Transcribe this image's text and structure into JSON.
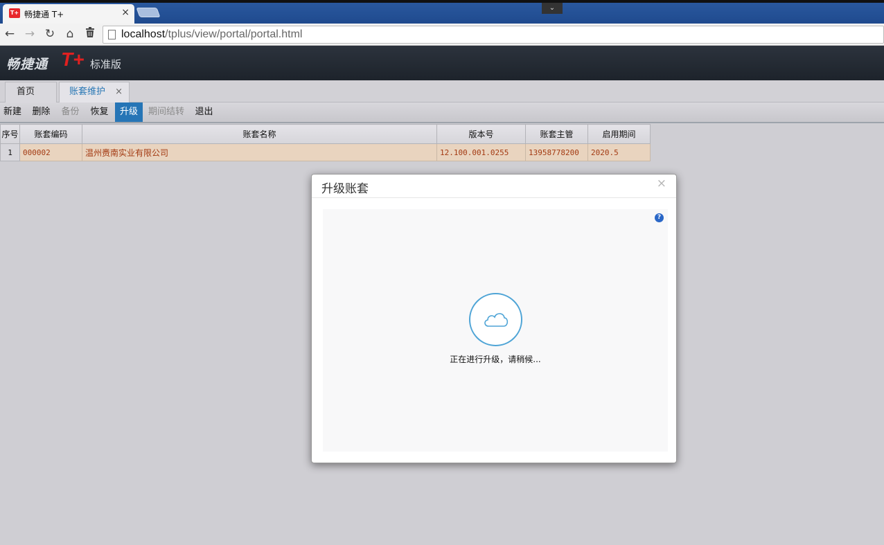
{
  "browser": {
    "tab_title": "畅捷通 T+",
    "favicon_text": "T+",
    "tab_close": "×",
    "url_host": "localhost",
    "url_path": "/tplus/view/portal/portal.html"
  },
  "app": {
    "logo_cn": "畅捷通",
    "logo_t": "T+",
    "edition": "标准版"
  },
  "tabs": {
    "home": "首页",
    "active": "账套维护",
    "close": "×"
  },
  "commands": [
    "新建",
    "删除",
    "备份",
    "恢复",
    "升级",
    "期间结转",
    "退出"
  ],
  "grid": {
    "headers": [
      "序号",
      "账套编码",
      "账套名称",
      "版本号",
      "账套主管",
      "启用期间"
    ],
    "rows": [
      {
        "seq": "1",
        "code": "000002",
        "name": "温州赉南实业有限公司",
        "version": "12.100.001.0255",
        "manager": "13958778200",
        "period": "2020.5"
      }
    ]
  },
  "modal": {
    "title": "升级账套",
    "close": "×",
    "help": "?",
    "status": "正在进行升级，请稍候..."
  },
  "colors": {
    "selected_command": "#2675b6",
    "row_highlight": "#e9d4bf",
    "spinner": "#4ea4d6"
  }
}
